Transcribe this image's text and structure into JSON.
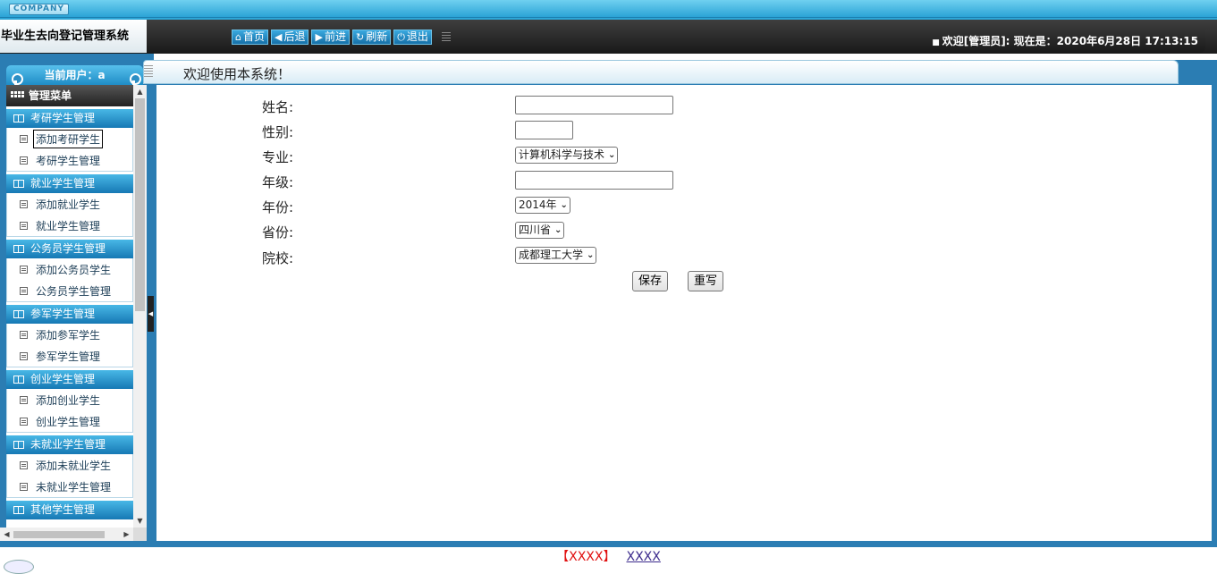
{
  "header": {
    "company": "COMPANY",
    "system_title": "毕业生去向登记管理系统",
    "toolbar": [
      {
        "label": "首页",
        "icon": "home-icon",
        "glyph": "⌂"
      },
      {
        "label": "后退",
        "icon": "back-arrow-icon",
        "glyph": "◀"
      },
      {
        "label": "前进",
        "icon": "forward-arrow-icon",
        "glyph": "▶"
      },
      {
        "label": "刷新",
        "icon": "refresh-icon",
        "glyph": "↻"
      },
      {
        "label": "退出",
        "icon": "power-icon",
        "glyph": "⏻"
      }
    ],
    "welcome": "欢迎[管理员]:",
    "now_label": "现在是：2020年6月28日 17:13:15"
  },
  "sidebar": {
    "current_user": "当前用户：a",
    "menu_title": "管理菜单",
    "groups": [
      {
        "title": "考研学生管理",
        "items": [
          "添加考研学生",
          "考研学生管理"
        ]
      },
      {
        "title": "就业学生管理",
        "items": [
          "添加就业学生",
          "就业学生管理"
        ]
      },
      {
        "title": "公务员学生管理",
        "items": [
          "添加公务员学生",
          "公务员学生管理"
        ]
      },
      {
        "title": "参军学生管理",
        "items": [
          "添加参军学生",
          "参军学生管理"
        ]
      },
      {
        "title": "创业学生管理",
        "items": [
          "添加创业学生",
          "创业学生管理"
        ]
      },
      {
        "title": "未就业学生管理",
        "items": [
          "添加未就业学生",
          "未就业学生管理"
        ]
      },
      {
        "title": "其他学生管理",
        "items": []
      }
    ]
  },
  "main": {
    "tab_title": "欢迎使用本系统！",
    "form": {
      "name_label": "姓名:",
      "name_value": "",
      "gender_label": "性别:",
      "gender_value": "",
      "major_label": "专业:",
      "major_value": "计算机科学与技术",
      "grade_label": "年级:",
      "grade_value": "",
      "year_label": "年份:",
      "year_value": "2014年",
      "province_label": "省份:",
      "province_value": "四川省",
      "school_label": "院校:",
      "school_value": "成都理工大学",
      "save_label": "保存",
      "reset_label": "重写"
    }
  },
  "footer": {
    "bracket_text": "【XXXX】",
    "link_text": "XXXX"
  },
  "colors": {
    "accent_blue": "#2b7db3",
    "header_dark": "#1c1c1c",
    "footer_red": "#e01010"
  }
}
